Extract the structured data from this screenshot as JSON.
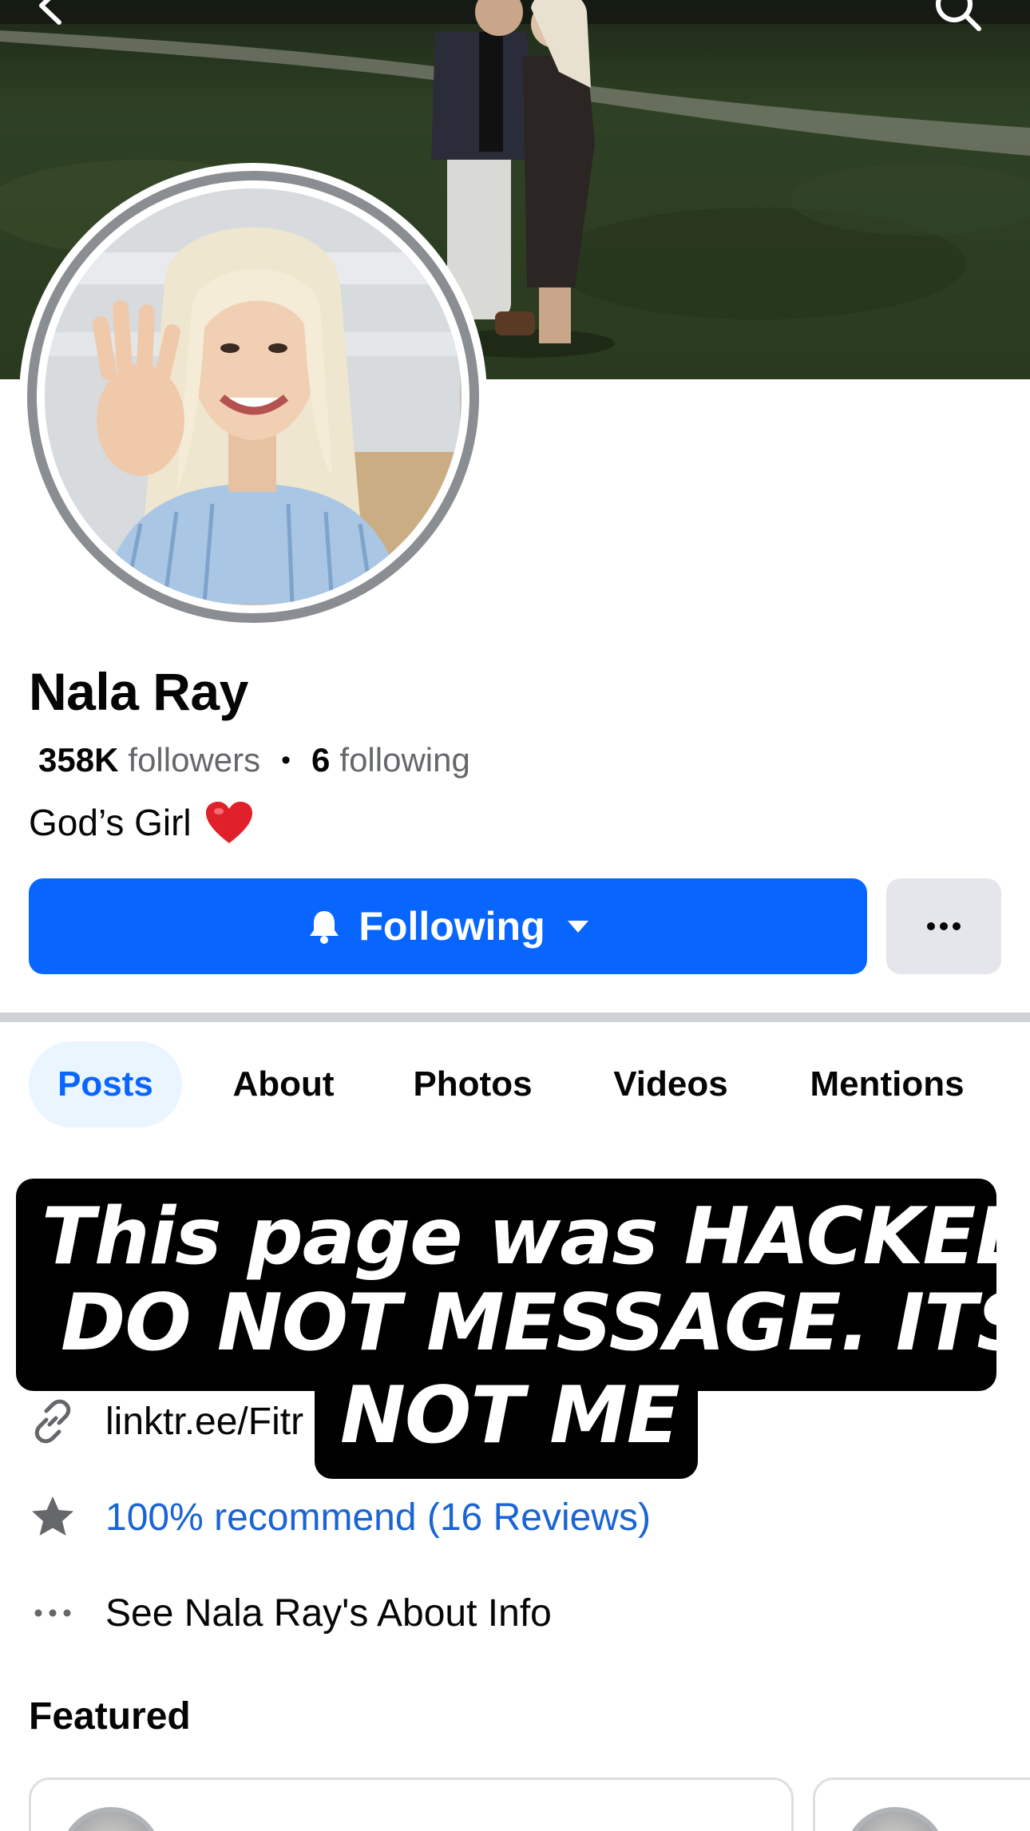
{
  "profile": {
    "name": "Nala Ray",
    "followers_count": "358K",
    "followers_label": "followers",
    "following_count": "6",
    "following_label": "following",
    "bio": "God’s Girl"
  },
  "actions": {
    "following_label": "Following",
    "more_label": "···"
  },
  "tabs": [
    {
      "label": "Posts",
      "active": true
    },
    {
      "label": "About",
      "active": false
    },
    {
      "label": "Photos",
      "active": false
    },
    {
      "label": "Videos",
      "active": false
    },
    {
      "label": "Mentions",
      "active": false
    }
  ],
  "banner": {
    "line1": "This page was HACKED",
    "line2": "DO NOT MESSAGE. ITS",
    "line3": "NOT ME"
  },
  "info": {
    "link": "linktr.ee/Fitr",
    "recommend": "100% recommend (16 Reviews)",
    "about": "See Nala Ray's About Info"
  },
  "featured": {
    "title": "Featured"
  },
  "colors": {
    "primary": "#0866ff",
    "link_blue": "#1a64d4",
    "tab_active_bg": "#ebf5ff",
    "secondary_button": "#e4e6eb",
    "muted_text": "#65676b",
    "banner_bg": "#000000"
  },
  "icons": {
    "back": "chevron-left-icon",
    "search": "search-icon",
    "bell": "bell-icon",
    "caret": "caret-down-icon",
    "more": "more-dots-icon",
    "link": "link-icon",
    "star": "star-icon",
    "about": "ellipsis-icon",
    "heart": "heart-emoji-icon"
  }
}
